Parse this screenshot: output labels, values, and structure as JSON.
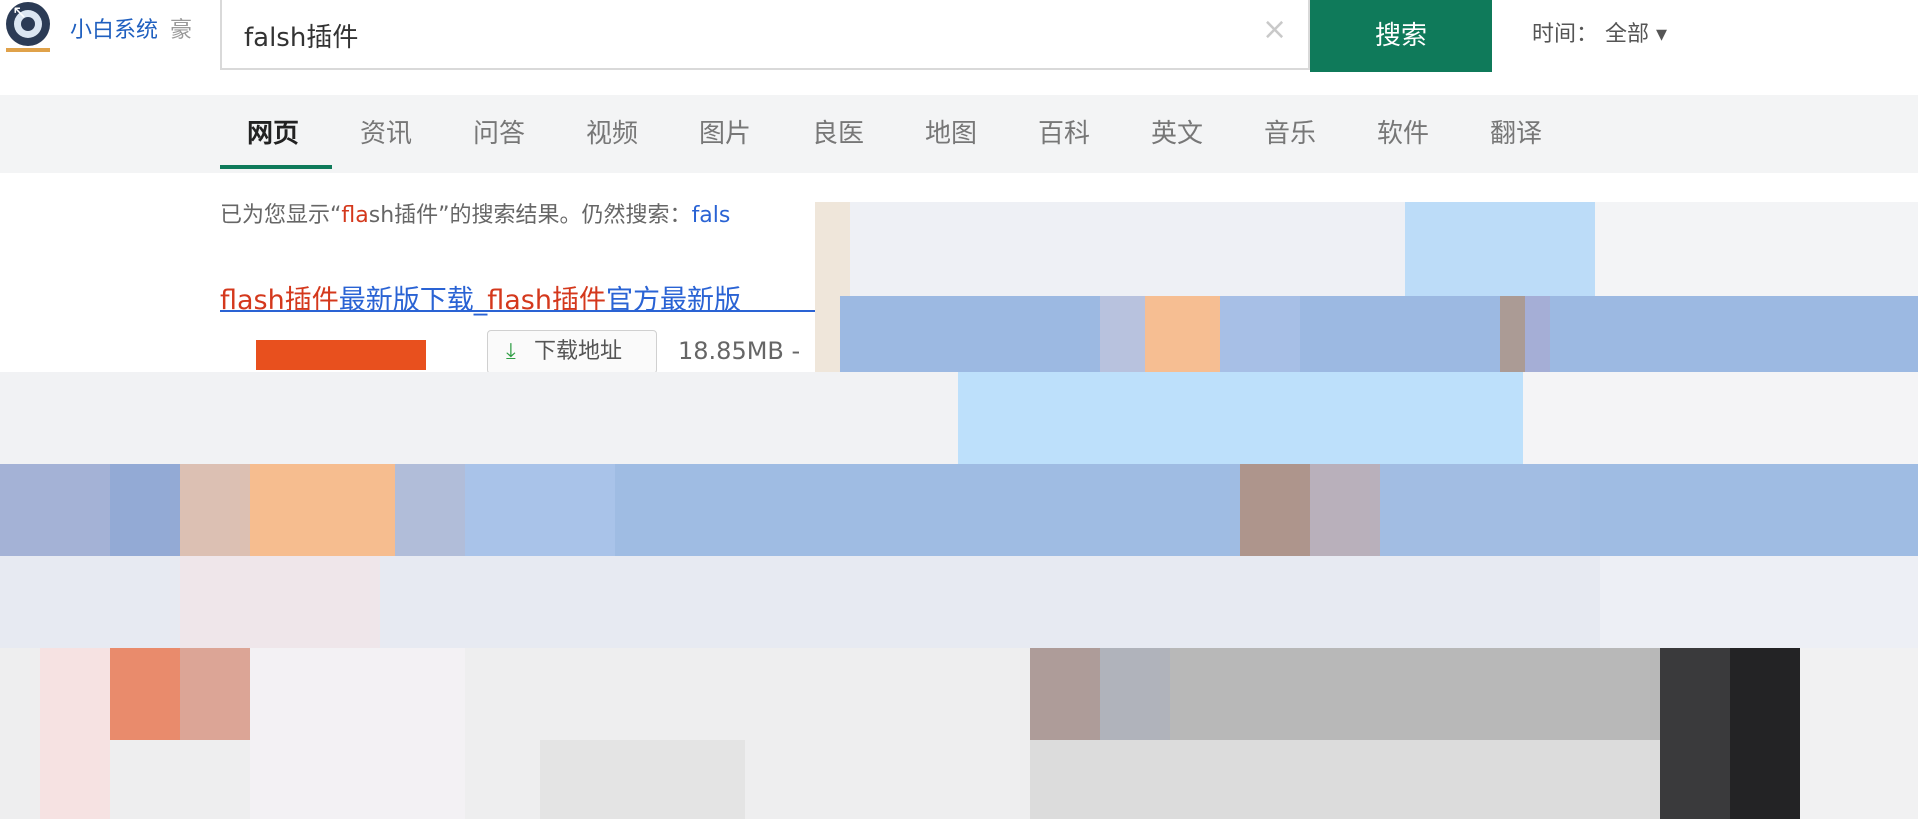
{
  "logo": {
    "brand": "小白系统",
    "tail": "豪",
    "back_glyph": "↖"
  },
  "search": {
    "value": "falsh插件",
    "button_label": "搜索",
    "clear_glyph": "×"
  },
  "time_filter": {
    "label": "时间：",
    "value": "全部"
  },
  "tabs": [
    "网页",
    "资讯",
    "问答",
    "视频",
    "图片",
    "良医",
    "地图",
    "百科",
    "英文",
    "音乐",
    "软件",
    "翻译"
  ],
  "notice": {
    "prefix": "已为您显示“",
    "highlight_a": "fla",
    "highlight_b": "sh插件",
    "suffix": "”的搜索结果。仍然搜索：",
    "link": "fals"
  },
  "result": {
    "title_red_1": "flash插件",
    "title_blue_1": "最新版下载_",
    "title_red_2": "flash插件",
    "title_blue_2": "官方最新版",
    "download_label": "下载地址",
    "file_size": "18.85MB - "
  },
  "colors": {
    "accent": "#0f7a5a",
    "link": "#2a63d4",
    "highlight": "#d4381c"
  }
}
